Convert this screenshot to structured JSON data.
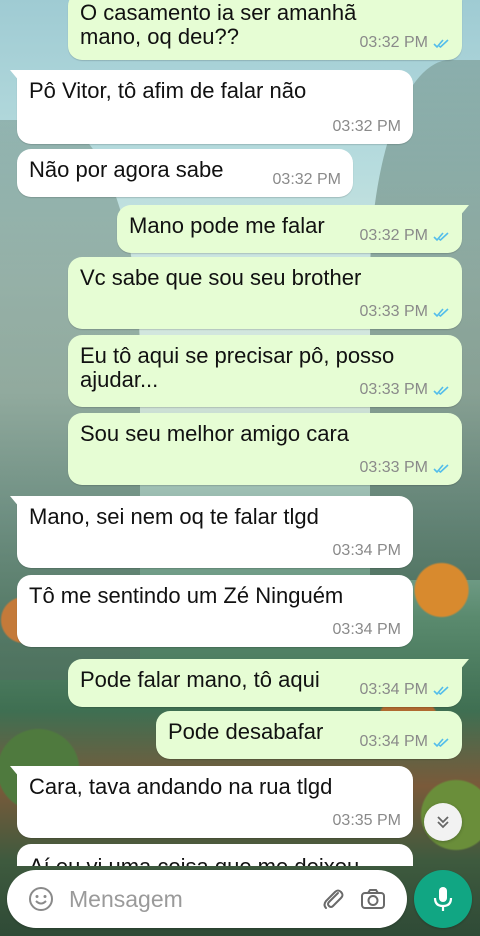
{
  "chat": {
    "messages": [
      {
        "dir": "out",
        "text": "O casamento ia ser amanhã mano, oq deu??",
        "time": "03:32 PM",
        "read": true
      },
      {
        "dir": "in",
        "text": "Pô Vitor, tô afim de falar não",
        "time": "03:32 PM"
      },
      {
        "dir": "in",
        "text": "Não por agora sabe",
        "time": "03:32 PM"
      },
      {
        "dir": "out",
        "text": "Mano pode me falar",
        "time": "03:32 PM",
        "read": true
      },
      {
        "dir": "out",
        "text": "Vc sabe que sou seu brother",
        "time": "03:33 PM",
        "read": true
      },
      {
        "dir": "out",
        "text": "Eu tô aqui se precisar pô, posso ajudar...",
        "time": "03:33 PM",
        "read": true
      },
      {
        "dir": "out",
        "text": "Sou seu melhor amigo cara",
        "time": "03:33 PM",
        "read": true
      },
      {
        "dir": "in",
        "text": "Mano, sei nem oq te falar tlgd",
        "time": "03:34 PM"
      },
      {
        "dir": "in",
        "text": "Tô me sentindo um Zé Ninguém",
        "time": "03:34 PM"
      },
      {
        "dir": "out",
        "text": "Pode falar mano, tô aqui",
        "time": "03:34 PM",
        "read": true
      },
      {
        "dir": "out",
        "text": "Pode desabafar",
        "time": "03:34 PM",
        "read": true
      },
      {
        "dir": "in",
        "text": "Cara, tava andando na rua tlgd",
        "time": "03:35 PM"
      }
    ],
    "partial_text": "Aí eu vi uma coisa que me deixou"
  },
  "composer": {
    "placeholder": "Mensagem",
    "emoji_icon": "emoji-icon",
    "attach_icon": "paperclip-icon",
    "camera_icon": "camera-icon",
    "mic_icon": "microphone-icon"
  },
  "scroll_icon": "double-chevron-down-icon",
  "colors": {
    "incoming_bubble": "#ffffff",
    "outgoing_bubble": "#e6fdd4",
    "read_ticks": "#53bdeb",
    "mic_button": "#11a683"
  }
}
